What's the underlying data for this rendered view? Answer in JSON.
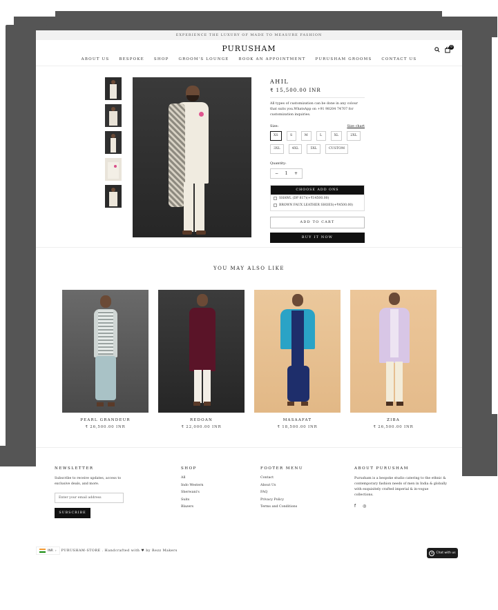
{
  "announcement": "EXPERIENCE THE LUXURY OF MADE TO MEASURE FASHION",
  "brand": "PURUSHAM",
  "nav": [
    "ABOUT US",
    "BESPOKE",
    "SHOP",
    "GROOM'S LOUNGE",
    "BOOK AN APPOINTMENT",
    "PURUSHAM GROOMS",
    "CONTACT US"
  ],
  "header_icons": {
    "search": "search-icon",
    "cart": "cart-icon",
    "cart_count": "0"
  },
  "product": {
    "title": "AHIL",
    "price": "₹ 15,500.00 INR",
    "description": "All types of customization can be done in any colour that suits you.WhatsApp on +91 98204 74707 for customization inquiries.",
    "size_label": "Size:",
    "size_chart": "Size chart",
    "sizes": [
      "XS",
      "S",
      "M",
      "L",
      "XL",
      "2XL",
      "3XL",
      "4XL",
      "5XL",
      "CUSTOM"
    ],
    "selected_size": "XS",
    "quantity_label": "Quantity:",
    "quantity": "1",
    "minus": "−",
    "plus": "+",
    "addons_title": "CHOOSE ADD ONS",
    "addons": [
      "SHAWL (DP 817)(+₹14500.00)",
      "BROWN FAUX LEATHER SHOES(+₹4500.00)"
    ],
    "add_to_cart": "ADD TO CART",
    "buy_now": "BUY IT NOW"
  },
  "also_like": {
    "heading": "YOU MAY ALSO LIKE",
    "items": [
      {
        "name": "PEARL GRANDEUR",
        "price": "₹ 26,500.00 INR"
      },
      {
        "name": "REDOAN",
        "price": "₹ 22,000.00 INR"
      },
      {
        "name": "MASAAFAT",
        "price": "₹ 18,500.00 INR"
      },
      {
        "name": "ZIBA",
        "price": "₹ 26,500.00 INR"
      }
    ]
  },
  "footer": {
    "newsletter": {
      "title": "NEWSLETTER",
      "text": "Subscribe to receive updates, access to exclusive deals, and more.",
      "placeholder": "Enter your email address",
      "button": "SUBSCRIBE"
    },
    "shop": {
      "title": "SHOP",
      "links": [
        "All",
        "Indo Western",
        "Sherwani's",
        "Suits",
        "Blazers"
      ]
    },
    "menu": {
      "title": "FOOTER MENU",
      "links": [
        "Contact",
        "About Us",
        "FAQ",
        "Privacy Policy",
        "Terms and Conditions"
      ]
    },
    "about": {
      "title": "ABOUT PURUSHAM",
      "text": "Purusham is a bespoke studio catering to the ethnic & contemporary fashion needs of men in India & globally with exquisitely crafted imperial & in-vogue collections.",
      "social": [
        "f",
        "◎"
      ]
    },
    "locale": "INR",
    "copyright": "PURUSHAM-STORE . Handcrafted with ♥ by Rezz Makers",
    "chat": "Chat with us"
  }
}
